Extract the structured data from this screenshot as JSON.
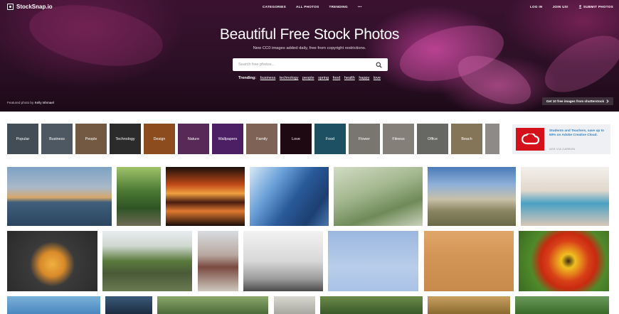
{
  "brand": {
    "name": "StockSnap.io"
  },
  "nav": {
    "center": [
      "CATEGORIES",
      "ALL PHOTOS",
      "TRENDING",
      "•••"
    ],
    "login": "LOG IN",
    "join": "JOIN US!",
    "submit": "SUBMIT PHOTOS"
  },
  "hero": {
    "title": "Beautiful Free Stock Photos",
    "subtitle": "New CC0 images added daily, free from copyright restrictions.",
    "search_placeholder": "Search free photos...",
    "trending_label": "Trending:",
    "trending": [
      "business",
      "technology",
      "people",
      "spring",
      "food",
      "health",
      "happy",
      "love"
    ],
    "featured_prefix": "Featured photo by",
    "featured_author": "Kelly Ishmael",
    "shutter_button": "Get 10 free images from shutterstock"
  },
  "categories": [
    {
      "label": "Popular",
      "color": "#5c6b78"
    },
    {
      "label": "Business",
      "color": "#6d7a8a"
    },
    {
      "label": "People",
      "color": "#a07a5c"
    },
    {
      "label": "Technology",
      "color": "#3c3c3c"
    },
    {
      "label": "Design",
      "color": "#c36a2a"
    },
    {
      "label": "Nature",
      "color": "#7a3a78"
    },
    {
      "label": "Wallpapers",
      "color": "#6a2c8c"
    },
    {
      "label": "Family",
      "color": "#b08878"
    },
    {
      "label": "Love",
      "color": "#2a0c18"
    },
    {
      "label": "Food",
      "color": "#2a6f8a"
    },
    {
      "label": "Flower",
      "color": "#a8a49a"
    },
    {
      "label": "Fitness",
      "color": "#b7b2a8"
    },
    {
      "label": "Office",
      "color": "#8f8f8a"
    },
    {
      "label": "Beach",
      "color": "#b8a27a"
    },
    {
      "label": "",
      "color": "#c4c0bb"
    }
  ],
  "ad": {
    "text": "Students and Teachers, save up to 60% on Adobe Creative Cloud.",
    "via": "ADS VIA CARBON",
    "logo_color": "#d4101a"
  },
  "photos": [
    {
      "desc": "ocean-sunset",
      "bg": "linear-gradient(180deg,#7da2c4 0%,#a9b9c9 35%,#d6a66a 52%,#3f5f7a 60%,#2a4460 100%)"
    },
    {
      "desc": "forest-path-runner",
      "bg": "linear-gradient(180deg,#9fc36a 0%,#4c7a34 40%,#2f5424 70%,#6e6a55 100%)"
    },
    {
      "desc": "light-trails",
      "bg": "linear-gradient(180deg,#1a0f0a 0%,#c24a18 30%,#f0a040 45%,#4a1c10 60%,#e07a30 75%,#1a0c08 100%)"
    },
    {
      "desc": "glass-skyscraper",
      "bg": "linear-gradient(125deg,#d8e8f6 0%,#6aa0d8 30%,#2a5a9a 55%,#1c3f70 80%,#4a78b0 100%)"
    },
    {
      "desc": "grass-closeup",
      "bg": "linear-gradient(160deg,#d2dcc4 0%,#a4b890 40%,#6f8a58 70%,#c9d2bc 100%)"
    },
    {
      "desc": "joshua-tree-desert",
      "bg": "linear-gradient(180deg,#4a7ab8 0%,#8fb0d8 30%,#c8c0a8 55%,#8a8460 75%,#6a6a48 100%)"
    },
    {
      "desc": "couple-cooking",
      "bg": "linear-gradient(180deg,#f2efea 0%,#e2d8cc 40%,#4aa0c4 62%,#d8c8b8 100%)"
    },
    {
      "desc": "orange-rose",
      "bg": "radial-gradient(circle at 50% 55%,#f0b040 0%,#d88a2a 22%,#3a3a3a 40%,#2a2a2a 100%)"
    },
    {
      "desc": "elephants-savanna",
      "bg": "linear-gradient(180deg,#e8ecef 0%,#cfd8d0 25%,#5a7a3c 50%,#4a5a38 70%,#6a7a50 100%)"
    },
    {
      "desc": "woman-pink-chair",
      "bg": "linear-gradient(180deg,#d8dce0 0%,#b8a8a0 40%,#7a4a40 60%,#cfc8c0 100%)"
    },
    {
      "desc": "bare-tree-bw",
      "bg": "linear-gradient(180deg,#f2f2f2 0%,#d8d8d8 50%,#9a9a9a 80%,#4a4a4a 100%)"
    },
    {
      "desc": "birds-blue-sky",
      "bg": "linear-gradient(180deg,#9cb8e0 0%,#b8cdea 60%,#a9c2e6 100%)"
    },
    {
      "desc": "woman-portrait",
      "bg": "linear-gradient(180deg,#e0a66a 0%,#d49656 40%,#c88a4a 100%)"
    },
    {
      "desc": "red-yellow-flower",
      "bg": "radial-gradient(circle at 55% 50%,#3a2a10 0%,#f0c020 12%,#d84018 35%,#c82a10 48%,#4f8a2a 65%,#3a6a22 100%)"
    },
    {
      "desc": "row3-a",
      "bg": "linear-gradient(180deg,#7ab0d8,#4a88c0)"
    },
    {
      "desc": "row3-b",
      "bg": "linear-gradient(180deg,#3a5a7a,#1c2c40)"
    },
    {
      "desc": "row3-c",
      "bg": "linear-gradient(180deg,#8aa86a,#4a6a3a)"
    },
    {
      "desc": "row3-d",
      "bg": "linear-gradient(180deg,#d8d8d0,#a8a8a0)"
    },
    {
      "desc": "row3-e",
      "bg": "linear-gradient(180deg,#6a8a4a,#3a5a2a)"
    },
    {
      "desc": "row3-f",
      "bg": "linear-gradient(180deg,#c8a060,#8a6a30)"
    },
    {
      "desc": "row3-g",
      "bg": "linear-gradient(180deg,#6a9a5a,#3a6a2a)"
    },
    {
      "desc": "row3-h",
      "bg": "linear-gradient(180deg,#7a9a8a,#4a6a5a)"
    }
  ]
}
